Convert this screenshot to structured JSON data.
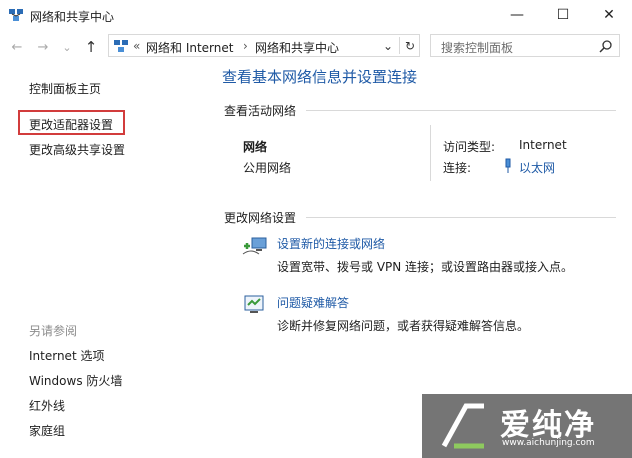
{
  "window": {
    "title": "网络和共享中心",
    "minimize_label": "—",
    "maximize_label": "☐",
    "close_label": "✕"
  },
  "nav": {
    "back_label": "←",
    "forward_label": "→",
    "recent_label": "⌄",
    "up_label": "↑"
  },
  "address": {
    "overflow": "«",
    "crumbs": [
      "网络和 Internet",
      "网络和共享中心"
    ],
    "separator": "›",
    "dropdown": "⌄",
    "refresh": "↻"
  },
  "search": {
    "placeholder": "搜索控制面板",
    "icon": "search-icon"
  },
  "sidebar": {
    "home": "控制面板主页",
    "items": [
      "更改适配器设置",
      "更改高级共享设置"
    ],
    "see_also_title": "另请参阅",
    "see_also": [
      "Internet 选项",
      "Windows 防火墙",
      "红外线",
      "家庭组"
    ]
  },
  "main": {
    "title": "查看基本网络信息并设置连接",
    "active_section": "查看活动网络",
    "network_name": "网络",
    "network_type": "公用网络",
    "access_type_label": "访问类型:",
    "access_type_value": "Internet",
    "connection_label": "连接:",
    "connection_value": "以太网",
    "change_section": "更改网络设置",
    "tasks": [
      {
        "link": "设置新的连接或网络",
        "desc": "设置宽带、拨号或 VPN 连接；或设置路由器或接入点。"
      },
      {
        "link": "问题疑难解答",
        "desc": "诊断并修复网络问题，或者获得疑难解答信息。"
      }
    ]
  },
  "watermark": {
    "text": "爱纯净",
    "url": "www.aichunjing.com"
  }
}
